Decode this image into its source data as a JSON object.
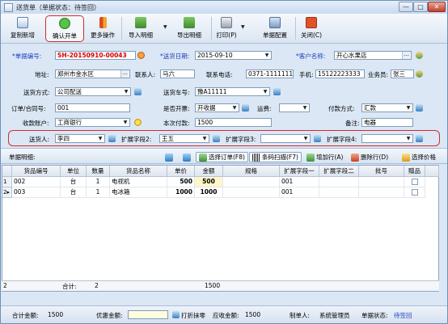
{
  "window": {
    "title": "送货单（单据状态：待签回）",
    "min_label": "—",
    "max_label": "□",
    "close_label": "✕"
  },
  "toolbar": {
    "copy_new": "复制新增",
    "confirm": "确认开单",
    "more_ops": "更多操作",
    "import_detail": "导入明细",
    "export_detail": "导出明细",
    "print": "打印(P)",
    "doc_config": "单据配置",
    "close": "关闭(C)"
  },
  "form": {
    "doc_no_label": "*单据编号:",
    "doc_no": "SH-20150910-00043",
    "date_label": "*送货日期:",
    "date": "2015-09-10",
    "customer_label": "*客户名称:",
    "customer": "开心水果店",
    "address_label": "地址:",
    "address": "郑州市金水区",
    "contact_label": "联系人:",
    "contact": "马六",
    "phone_label": "联系电话:",
    "phone": "0371-11111111",
    "mobile_label": "手机:",
    "mobile": "15122223333",
    "salesman_label": "业务员:",
    "salesman": "张三",
    "ship_method_label": "送货方式:",
    "ship_method": "公司配送",
    "vehicle_label": "送货车号:",
    "vehicle": "豫A11111",
    "order_no_label": "订单/合同号:",
    "order_no": "001",
    "invoice_label": "是否开票:",
    "invoice": "开收据",
    "freight_label": "运费:",
    "freight": "",
    "payment_label": "付款方式:",
    "payment": "汇款",
    "account_label": "收款账户:",
    "account": "工商银行",
    "this_payment_label": "本次付款:",
    "this_payment": "1500",
    "remark_label": "备注:",
    "remark": "电器",
    "deliverer_label": "送货人:",
    "deliverer": "李四",
    "ext2_label": "扩展字段2:",
    "ext2": "王五",
    "ext3_label": "扩展字段3:",
    "ext3": "",
    "ext4_label": "扩展字段4:",
    "ext4": ""
  },
  "detail": {
    "label": "单据明细:",
    "select_order": "选择订单(F8)",
    "barcode": "条码扫描(F7)",
    "add_row": "增加行(A)",
    "delete_row": "删除行(D)",
    "select_price": "选择价格"
  },
  "grid": {
    "columns": [
      "货品编号",
      "单位",
      "数量",
      "货品名称",
      "单价",
      "金额",
      "规格",
      "扩展字段一",
      "扩展字段二",
      "批号",
      "赠品"
    ],
    "rows": [
      {
        "num": "1",
        "code": "002",
        "unit": "台",
        "qty": "1",
        "name": "电视机",
        "price": "500",
        "amount": "500",
        "spec": "",
        "ext1": "001",
        "ext2": "",
        "batch": "",
        "gift": false
      },
      {
        "num": "2",
        "code": "003",
        "unit": "台",
        "qty": "1",
        "name": "电冰箱",
        "price": "1000",
        "amount": "1000",
        "spec": "",
        "ext1": "001",
        "ext2": "",
        "batch": "",
        "gift": false
      }
    ],
    "sum_label": "合计:",
    "sum_qty": "2",
    "sum_amount": "1500",
    "sum_row_num": "2"
  },
  "footer": {
    "total_label": "合计金额:",
    "total": "1500",
    "discount_label": "优惠金额:",
    "discount": "",
    "round_label": "打折抹零",
    "receivable_label": "应收金额:",
    "receivable": "1500",
    "maker_label": "制单人:",
    "maker": "系统管理员",
    "status_label": "单据状态:",
    "status": "待签回"
  },
  "colors": {
    "required_label": "#1d3fbf",
    "doc_no_text": "#d40000",
    "highlight_border": "#d42a2a",
    "status_text": "#1d3fbf"
  }
}
